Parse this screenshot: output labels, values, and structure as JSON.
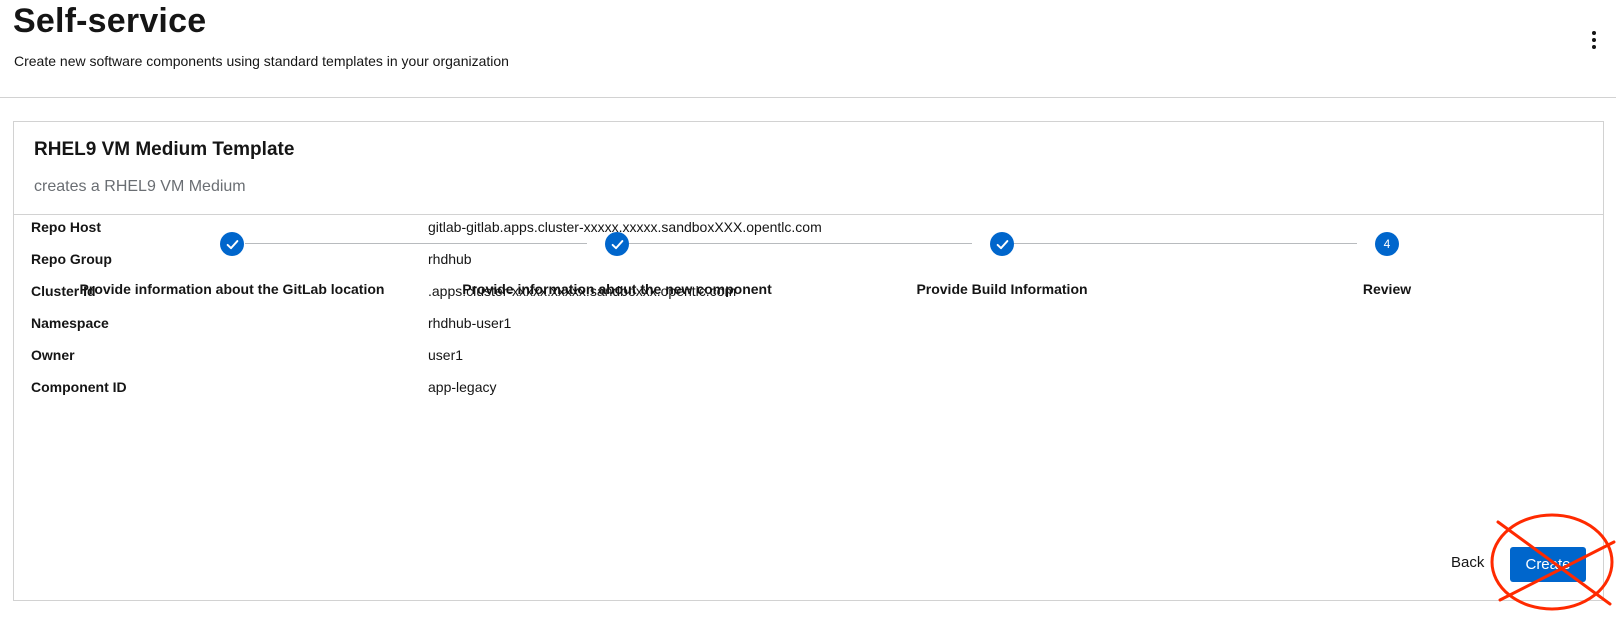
{
  "header": {
    "title": "Self-service",
    "subtitle": "Create new software components using standard templates in your organization",
    "menu_icon": "kebab-icon"
  },
  "template": {
    "title": "RHEL9 VM Medium Template",
    "description": "creates a RHEL9 VM Medium"
  },
  "steps": [
    {
      "label": "Provide information about the GitLab location",
      "state": "complete",
      "number": "1"
    },
    {
      "label": "Provide information about the new component",
      "state": "complete",
      "number": "2"
    },
    {
      "label": "Provide Build Information",
      "state": "complete",
      "number": "3"
    },
    {
      "label": "Review",
      "state": "current",
      "number": "4"
    }
  ],
  "review": [
    {
      "key": "Repo Host",
      "value": "gitlab-gitlab.apps.cluster-xxxxx.xxxxx.sandboxXXX.opentlc.com"
    },
    {
      "key": "Repo Group",
      "value": "rhdhub"
    },
    {
      "key": "Cluster Id",
      "value": ".apps.cluster-xxxxx.xxxxx.sandboxxx.opentlc.com"
    },
    {
      "key": "Namespace",
      "value": "rhdhub-user1"
    },
    {
      "key": "Owner",
      "value": "user1"
    },
    {
      "key": "Component ID",
      "value": "app-legacy"
    }
  ],
  "actions": {
    "back_label": "Back",
    "create_label": "Create"
  },
  "colors": {
    "primary": "#0066cc",
    "annotation": "#ff2a00"
  }
}
